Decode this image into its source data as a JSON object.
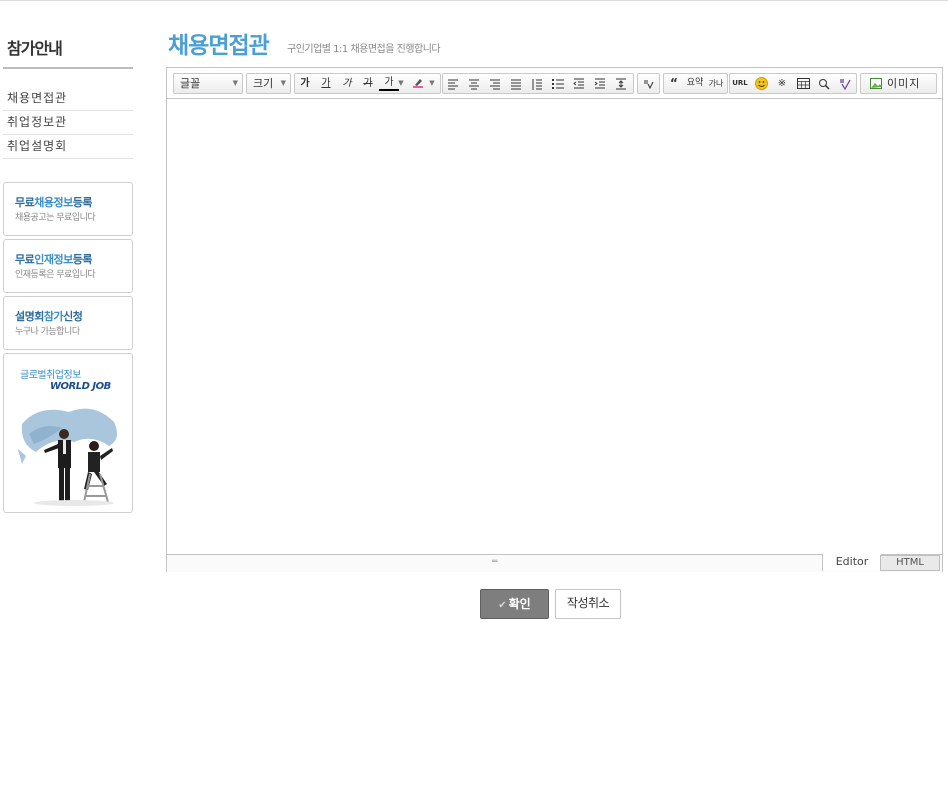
{
  "sidebar": {
    "title": "참가안내",
    "menu": [
      "채용면접관",
      "취업정보관",
      "취업설명회"
    ],
    "boxes": [
      {
        "title_a": "무료",
        "title_hl": "채용정보",
        "title_b": "등록",
        "sub": "채용공고는 무료입니다"
      },
      {
        "title_a": "무료",
        "title_hl": "인재정보",
        "title_b": "등록",
        "sub": "인재등록은 무료입니다"
      },
      {
        "title_a": "설명회",
        "title_hl": "참가",
        "title_b": "신청",
        "sub": "누구나 가능합니다"
      }
    ],
    "promo": {
      "title": "글로벌취업정보",
      "logo": "WORLD JOB"
    }
  },
  "header": {
    "title": "채용면접관",
    "subtitle": "구인기업별 1:1 채용면접을 진행합니다"
  },
  "editor": {
    "font_select": "글꼴",
    "size_select": "크기",
    "buttons": {
      "bold": "가",
      "underline": "가",
      "italic": "가",
      "strike": "가",
      "fontcolor": "가",
      "bgcolor": "가",
      "quote": "“",
      "summary": "요약",
      "sup": "가나",
      "url": "URL",
      "image": "이미지"
    },
    "mode_tabs": {
      "editor": "Editor",
      "html": "HTML"
    }
  },
  "actions": {
    "confirm": "확인",
    "cancel": "작성취소"
  },
  "colors": {
    "title_blue": "#4a9fd4",
    "box_title_blue": "#2f6d9e",
    "confirm_bg": "#7e7e7e"
  }
}
